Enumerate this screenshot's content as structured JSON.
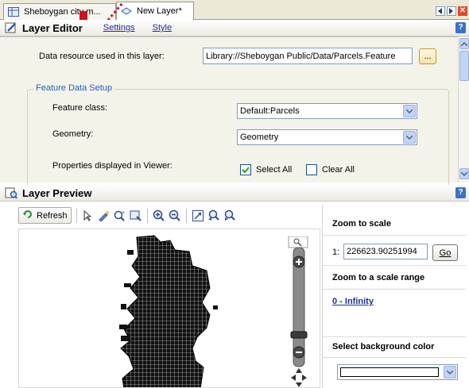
{
  "tabs": [
    {
      "label": "Sheboygan city m..."
    },
    {
      "label": "New Layer*"
    }
  ],
  "layer_editor": {
    "title": "Layer Editor",
    "links": [
      "Settings",
      "Style"
    ],
    "data_resource_label": "Data resource used in this layer:",
    "data_resource_value": "Library://Sheboygan Public/Data/Parcels.Feature",
    "browse_label": "...",
    "group_title": "Feature Data Setup",
    "feature_class_label": "Feature class:",
    "feature_class_value": "Default:Parcels",
    "geometry_label": "Geometry:",
    "geometry_value": "Geometry",
    "properties_label": "Properties displayed in Viewer:",
    "select_all_label": "Select All",
    "select_all_checked": true,
    "clear_all_label": "Clear All",
    "clear_all_checked": false
  },
  "layer_preview": {
    "title": "Layer Preview",
    "refresh_label": "Refresh",
    "toolbar_icons": [
      "select-arrow-icon",
      "pan-icon",
      "zoom-in-rect-icon",
      "zoom-out-rect-icon",
      "zoom-in-icon",
      "zoom-out-icon",
      "zoom-extents-icon",
      "zoom-previous-icon",
      "zoom-next-icon"
    ],
    "zoom_to_scale_title": "Zoom to scale",
    "scale_prefix": "1:",
    "scale_value": "226623.90251994",
    "go_label": "Go",
    "scale_range_title": "Zoom to a scale range",
    "scale_range_link": "0 - Infinity",
    "bg_color_title": "Select background color",
    "bg_color_value": "#ffffff"
  },
  "colors": {
    "accent_link": "#1b2f9c",
    "group_title": "#1f5ec4",
    "panel_bg": "#f4f3ea",
    "tab_close": "#e04a2a",
    "arrow_annotation": "#d0121b"
  }
}
